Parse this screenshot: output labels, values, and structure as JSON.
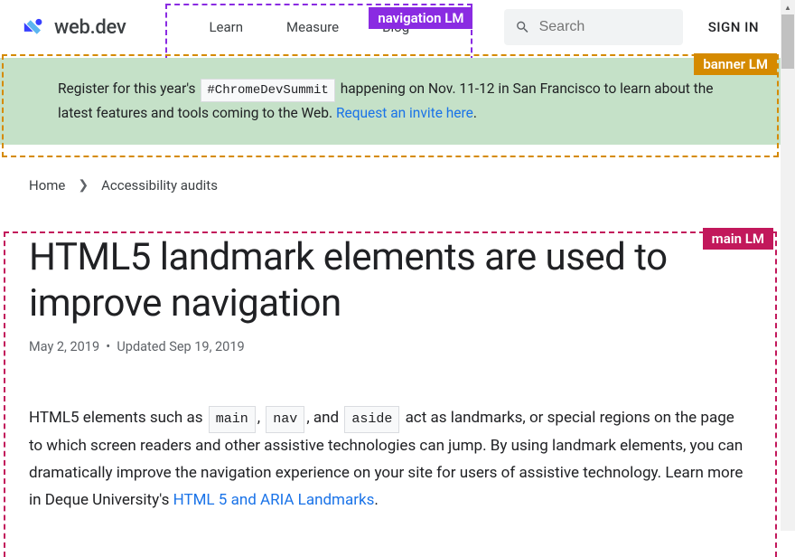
{
  "header": {
    "logo_text": "web.dev",
    "signin": "SIGN IN"
  },
  "nav": {
    "items": [
      "Learn",
      "Measure",
      "Blog"
    ],
    "overlay_label": "navigation LM"
  },
  "search": {
    "placeholder": "Search"
  },
  "banner": {
    "pre": "Register for this year's",
    "hashtag": "#ChromeDevSummit",
    "mid": "happening on Nov. 11-12 in San Francisco to learn about the latest features and tools coming to the Web.",
    "link": "Request an invite here",
    "suffix": ".",
    "overlay_label": "banner LM"
  },
  "breadcrumb": {
    "items": [
      "Home",
      "Accessibility audits"
    ]
  },
  "main": {
    "overlay_label": "main LM",
    "title": "HTML5 landmark elements are used to improve navigation",
    "date_published": "May 2, 2019",
    "date_sep": "•",
    "date_updated_label": "Updated",
    "date_updated": "Sep 19, 2019",
    "p1_a": "HTML5 elements such as",
    "code1": "main",
    "p1_b": ",",
    "code2": "nav",
    "p1_c": ", and",
    "code3": "aside",
    "p1_d": "act as landmarks, or special regions on the page to which screen readers and other assistive technologies can jump. By using landmark elements, you can dramatically improve the navigation experience on your site for users of assistive technology. Learn more in Deque University's",
    "link1": "HTML 5 and ARIA Landmarks",
    "p1_e": "."
  }
}
